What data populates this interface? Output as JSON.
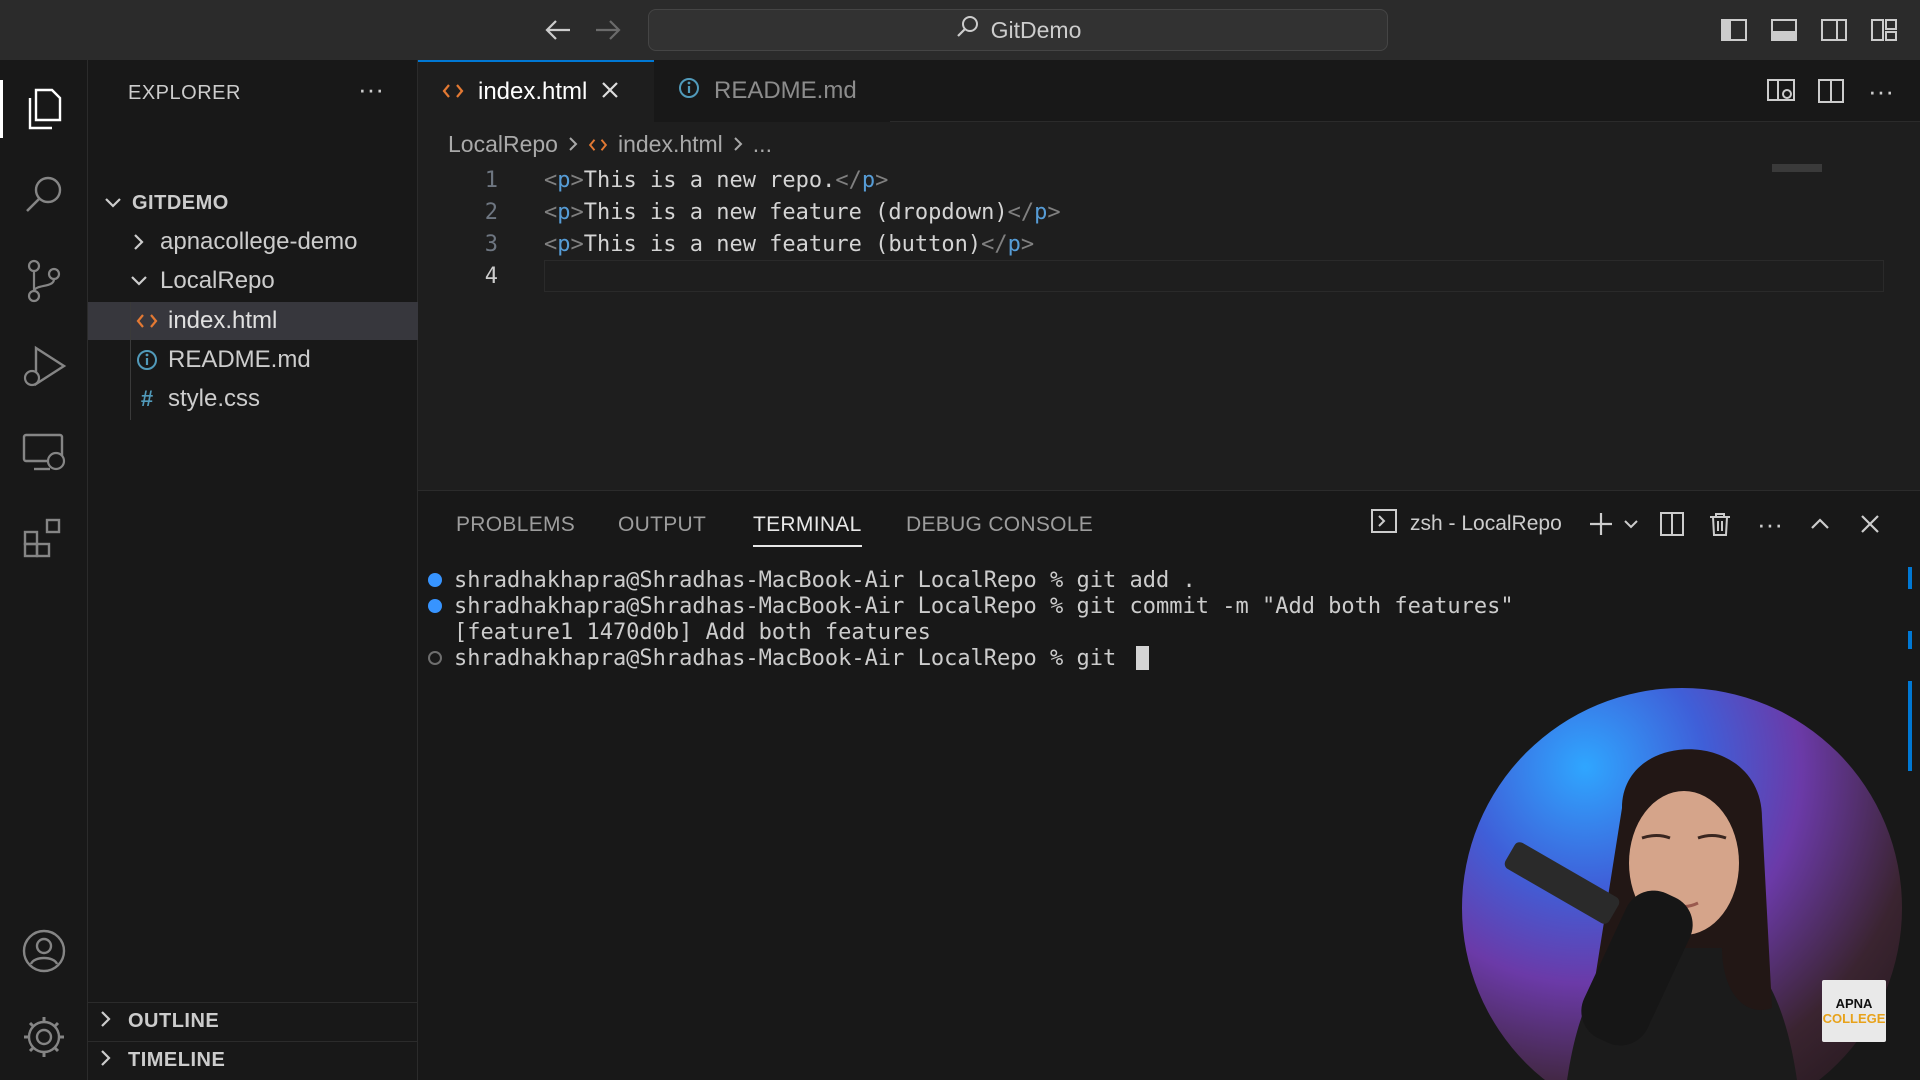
{
  "titlebar": {
    "search_text": "GitDemo"
  },
  "activity_bar": {
    "items": [
      "explorer-icon",
      "search-icon",
      "source-control-icon",
      "run-debug-icon",
      "remote-explorer-icon",
      "extensions-icon"
    ],
    "bottom": [
      "account-icon",
      "manage-gear-icon"
    ]
  },
  "sidebar": {
    "header": "EXPLORER",
    "more": "···",
    "root": "GITDEMO",
    "tree": [
      {
        "label": "apnacollege-demo",
        "type": "folder",
        "expanded": false
      },
      {
        "label": "LocalRepo",
        "type": "folder",
        "expanded": true
      },
      {
        "label": "index.html",
        "type": "html",
        "selected": true
      },
      {
        "label": "README.md",
        "type": "info"
      },
      {
        "label": "style.css",
        "type": "css"
      }
    ],
    "outline": "OUTLINE",
    "timeline": "TIMELINE"
  },
  "editor": {
    "tabs": [
      {
        "label": "index.html",
        "active": true
      },
      {
        "label": "README.md",
        "active": false
      }
    ],
    "breadcrumb": [
      "LocalRepo",
      "index.html",
      "..."
    ],
    "lines": [
      {
        "num": "1",
        "text": "This is a new repo."
      },
      {
        "num": "2",
        "text": "This is a new feature (dropdown)"
      },
      {
        "num": "3",
        "text": "This is a new feature (button)"
      },
      {
        "num": "4",
        "text": ""
      }
    ],
    "tag_open": "<p>",
    "tag_close": "</p>"
  },
  "panel": {
    "tabs": [
      "PROBLEMS",
      "OUTPUT",
      "TERMINAL",
      "DEBUG CONSOLE"
    ],
    "active_tab": "TERMINAL",
    "terminal_name": "zsh - LocalRepo",
    "lines": [
      {
        "marker": "blue",
        "text": "shradhakhapra@Shradhas-MacBook-Air LocalRepo % git add ."
      },
      {
        "marker": "blue",
        "text": "shradhakhapra@Shradhas-MacBook-Air LocalRepo % git commit -m \"Add both features\""
      },
      {
        "marker": "none",
        "text": "[feature1 1470d0b] Add both features"
      },
      {
        "marker": "hollow",
        "text": "shradhakhapra@Shradhas-MacBook-Air LocalRepo % git "
      }
    ]
  },
  "overlay": {
    "logo_line1": "APNA",
    "logo_line2": "COLLEGE"
  },
  "colors": {
    "accent": "#0078d4",
    "tag_name": "#569cd6",
    "html_icon": "#e37933",
    "info_icon": "#519aba",
    "css_icon": "#519aba"
  }
}
